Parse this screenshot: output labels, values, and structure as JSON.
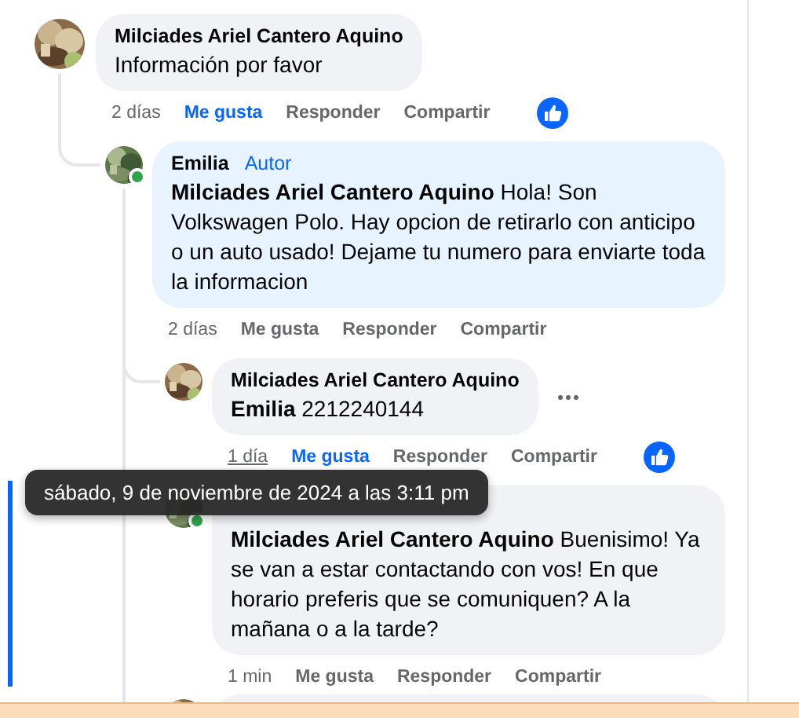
{
  "comments": [
    {
      "kind": "comment",
      "author": "Milciades Ariel Cantero Aquino",
      "text": "Información por favor",
      "time": "2 días",
      "time_hovered": false,
      "like": "Me gusta",
      "liked": true,
      "reply": "Responder",
      "share": "Compartir",
      "reaction": true,
      "children": [
        {
          "kind": "comment",
          "author": "Emilia",
          "badge": "Autor",
          "online": true,
          "text": "**Milciades Ariel Cantero Aquino** Hola! Son Volkswagen Polo. Hay opcion de retirarlo con anticipo o un auto usado! Dejame tu numero para enviarte toda la informacion",
          "time": "2 días",
          "time_hovered": false,
          "like": "Me gusta",
          "liked": false,
          "reply": "Responder",
          "share": "Compartir",
          "children": [
            {
              "kind": "comment",
              "author": "Milciades Ariel Cantero Aquino",
              "text": "**Emilia** 2212240144",
              "time": "1 día",
              "time_hovered": true,
              "like": "Me gusta",
              "liked": true,
              "reply": "Responder",
              "share": "Compartir",
              "reaction": true,
              "menu": true
            },
            {
              "kind": "comment",
              "online": true,
              "highlighted": true,
              "text": "**Milciades Ariel Cantero Aquino** Buenisimo! Ya se van a estar contactando con vos! En que horario preferis que se comuniquen? A la mañana o a la tarde?",
              "time": "1 min",
              "time_hovered": false,
              "like": "Me gusta",
              "liked": false,
              "reply": "Responder",
              "share": "Compartir"
            },
            {
              "kind": "cut"
            }
          ]
        }
      ]
    }
  ],
  "tooltip": {
    "text": "sábado, 9 de noviembre de 2024 a las 3:11 pm"
  }
}
